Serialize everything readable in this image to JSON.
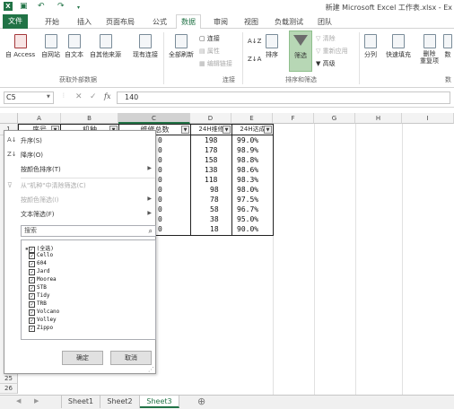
{
  "title_bar": {
    "document_title": "新建 Microsoft Excel 工作表.xlsx - Ex",
    "qat_icons": [
      "excel-logo-icon",
      "save-icon",
      "undo-icon",
      "redo-icon",
      "customize-icon"
    ]
  },
  "ribbon_tabs": [
    "文件",
    "开始",
    "插入",
    "页面布局",
    "公式",
    "数据",
    "审阅",
    "视图",
    "负载测试",
    "团队"
  ],
  "active_tab": "数据",
  "ribbon": {
    "get_external": {
      "buttons": [
        "自 Access",
        "自网站",
        "自文本",
        "自其他来源",
        "现有连接"
      ],
      "group_label": "获取外部数据"
    },
    "connections": {
      "refresh_all": "全部刷新",
      "items": [
        "连接",
        "属性",
        "编辑链接"
      ],
      "group_label": "连接"
    },
    "sort_filter": {
      "sort_az": "A↓Z",
      "sort_za": "Z↓A",
      "sort": "排序",
      "filter": "筛选",
      "clear": "清除",
      "reapply": "重新应用",
      "advanced": "高级",
      "group_label": "排序和筛选"
    },
    "data_tools": {
      "buttons": [
        "分列",
        "快速填充",
        "删除\n重复项",
        "数"
      ],
      "group_label": "数"
    }
  },
  "formula_bar": {
    "name_box": "C5",
    "cancel": "✕",
    "enter": "✓",
    "fx": "fx",
    "value": "140"
  },
  "grid": {
    "columns": [
      "A",
      "B",
      "C",
      "D",
      "E",
      "F",
      "G",
      "H",
      "I"
    ],
    "header_row": [
      "序号",
      "机种",
      "维修总数",
      "24H维修",
      "24H达成"
    ],
    "col_c_values": [
      "0",
      "0",
      "0",
      "0",
      "0",
      "0",
      "0",
      "0",
      "0",
      "0"
    ],
    "col_d_values": [
      "198",
      "178",
      "158",
      "138",
      "118",
      "98",
      "78",
      "58",
      "38",
      "18"
    ],
    "col_e_values": [
      "99.0%",
      "98.9%",
      "98.8%",
      "98.6%",
      "98.3%",
      "98.0%",
      "97.5%",
      "96.7%",
      "95.0%",
      "90.0%"
    ],
    "row_numbers_bottom": [
      "25",
      "26"
    ],
    "row_number_top": "1"
  },
  "filter_menu": {
    "items": [
      {
        "label": "升序(S)",
        "disabled": false,
        "submenu": false
      },
      {
        "label": "降序(O)",
        "disabled": false,
        "submenu": false
      },
      {
        "label": "按颜色排序(T)",
        "disabled": false,
        "submenu": true
      },
      {
        "label": "从\"机种\"中清除筛选(C)",
        "disabled": true,
        "submenu": false
      },
      {
        "label": "按颜色筛选(I)",
        "disabled": true,
        "submenu": true
      },
      {
        "label": "文本筛选(F)",
        "disabled": false,
        "submenu": true
      }
    ],
    "search_placeholder": "搜索",
    "list_items": [
      "(全选)",
      "Cello",
      "604",
      "Jard",
      "Moorea",
      "STB",
      "Tidy",
      "TRB",
      "Volcano",
      "Volley",
      "Zippo"
    ],
    "ok": "确定",
    "cancel": "取消"
  },
  "sheet_tabs": [
    "Sheet1",
    "Sheet2",
    "Sheet3"
  ],
  "active_sheet": "Sheet3",
  "new_sheet": "⊕",
  "colors": {
    "excel_green": "#217346",
    "filter_active": "#b7d7b5"
  }
}
